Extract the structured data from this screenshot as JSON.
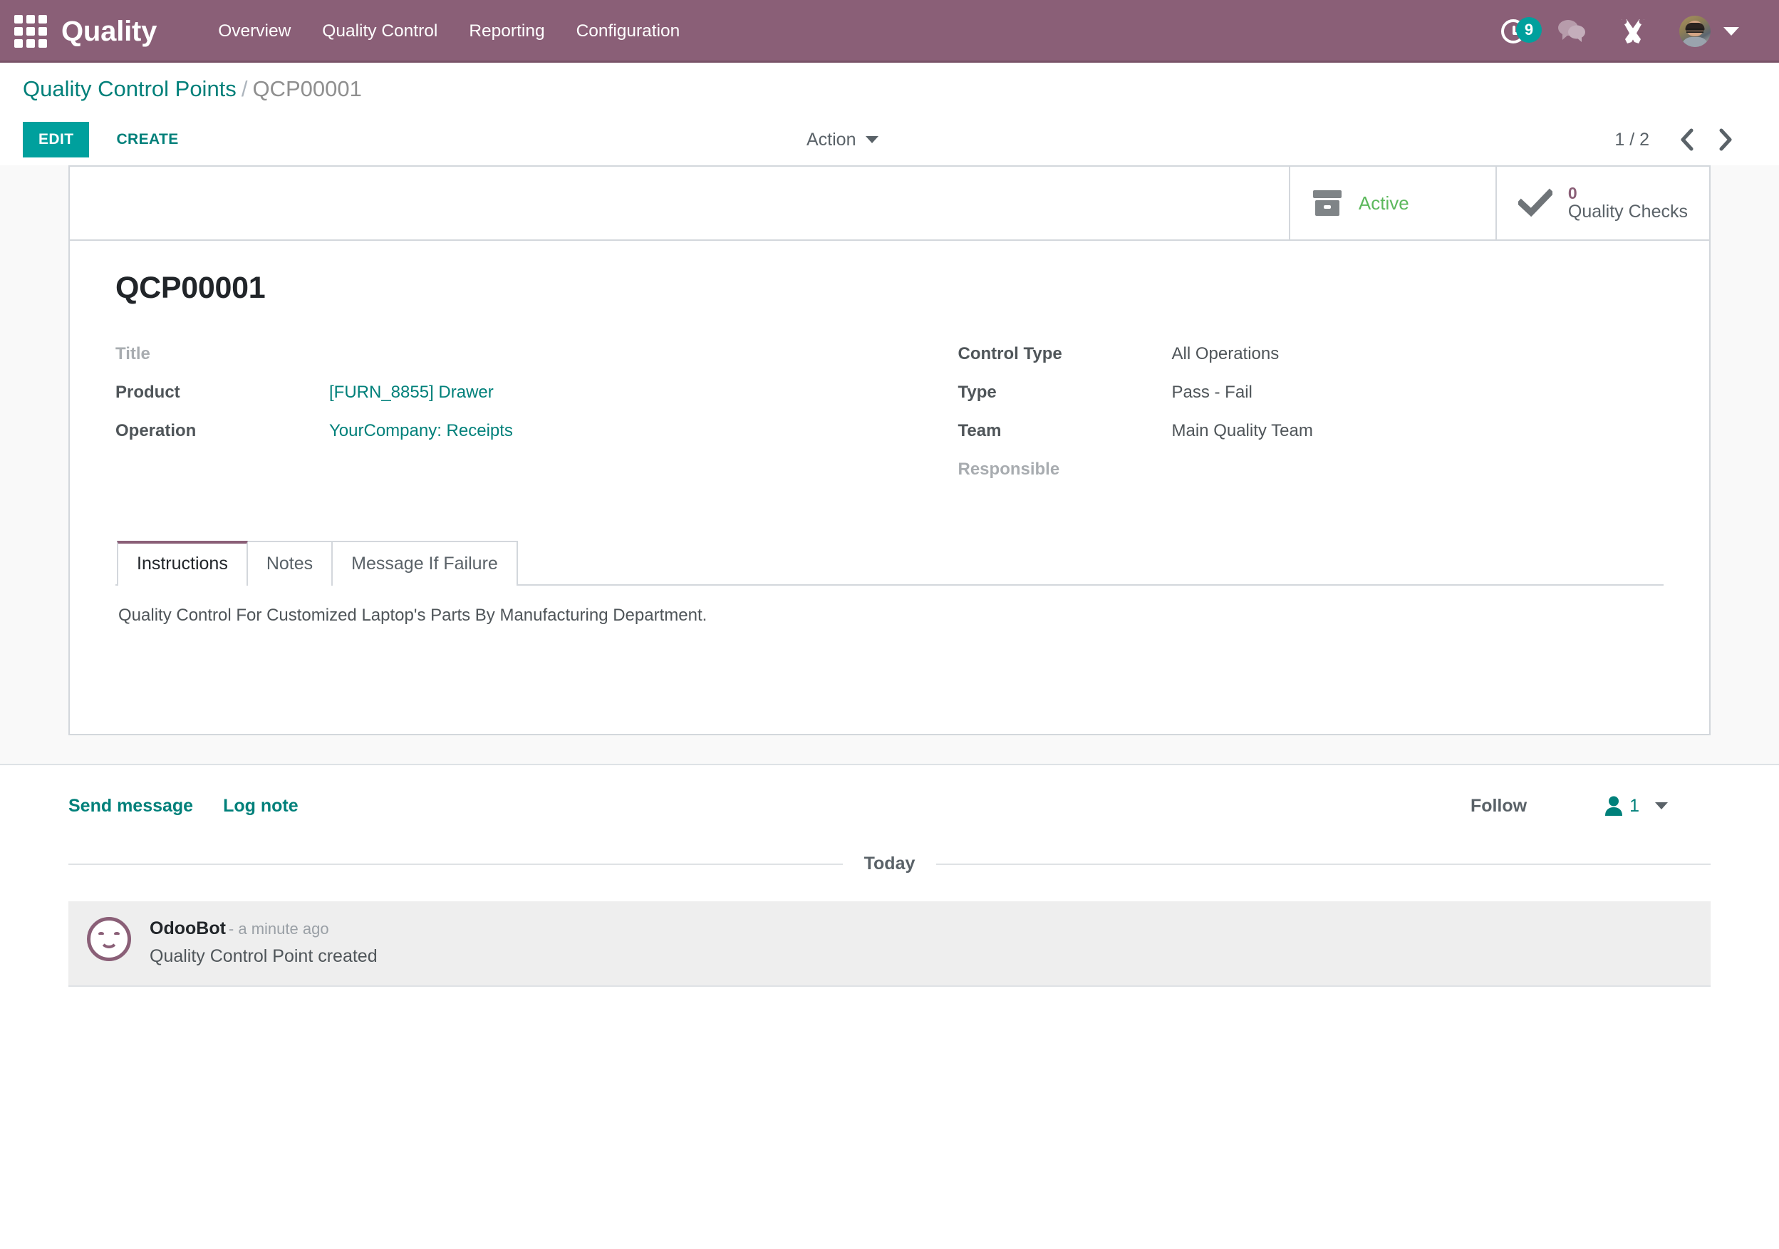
{
  "navbar": {
    "apps_icon": "apps-grid-icon",
    "brand": "Quality",
    "menu": [
      {
        "label": "Overview"
      },
      {
        "label": "Quality Control"
      },
      {
        "label": "Reporting"
      },
      {
        "label": "Configuration"
      }
    ],
    "activity_icon": "clock-icon",
    "activity_count": "9",
    "messaging_icon": "chat-bubbles-icon",
    "tools_icon": "wrench-screwdriver-icon",
    "avatar_icon": "user-avatar",
    "user_caret_icon": "chevron-down-icon",
    "colors": {
      "header_bg": "#8a5f77",
      "accent": "#00A09D",
      "link": "#00807a"
    }
  },
  "control_panel": {
    "breadcrumb_root": "Quality Control Points",
    "breadcrumb_separator": "/",
    "breadcrumb_current": "QCP00001",
    "edit_label": "EDIT",
    "create_label": "CREATE",
    "action_label": "Action",
    "action_caret_icon": "caret-down-icon",
    "pager_value": "1 / 2",
    "pager_prev_icon": "chevron-left-icon",
    "pager_next_icon": "chevron-right-icon"
  },
  "form": {
    "stat_buttons": [
      {
        "icon": "archive-box-icon",
        "label": "Active",
        "name": "active-toggle-button"
      },
      {
        "icon": "check-icon",
        "count": "0",
        "label": "Quality Checks",
        "name": "quality-checks-button"
      }
    ],
    "record_title": "QCP00001",
    "left_fields": [
      {
        "label": "Title",
        "value": "",
        "empty": true,
        "link": false
      },
      {
        "label": "Product",
        "value": "[FURN_8855] Drawer",
        "empty": false,
        "link": true
      },
      {
        "label": "Operation",
        "value": "YourCompany: Receipts",
        "empty": false,
        "link": true
      }
    ],
    "right_fields": [
      {
        "label": "Control Type",
        "value": "All Operations",
        "empty": false,
        "link": false
      },
      {
        "label": "Type",
        "value": "Pass - Fail",
        "empty": false,
        "link": false
      },
      {
        "label": "Team",
        "value": "Main Quality Team",
        "empty": false,
        "link": false
      },
      {
        "label": "Responsible",
        "value": "",
        "empty": true,
        "link": false
      }
    ],
    "tabs": [
      {
        "label": "Instructions",
        "active": true
      },
      {
        "label": "Notes",
        "active": false
      },
      {
        "label": "Message If Failure",
        "active": false
      }
    ],
    "instructions_text": "Quality Control For Customized Laptop's Parts By Manufacturing Department."
  },
  "chatter": {
    "send_message_label": "Send message",
    "log_note_label": "Log note",
    "follow_label": "Follow",
    "followers_icon": "user-icon",
    "followers_count": "1",
    "followers_caret_icon": "caret-down-icon",
    "day_separator": "Today",
    "messages": [
      {
        "avatar_icon": "odoobot-smiley-avatar",
        "author": "OdooBot",
        "time": "- a minute ago",
        "body": "Quality Control Point created"
      }
    ]
  }
}
